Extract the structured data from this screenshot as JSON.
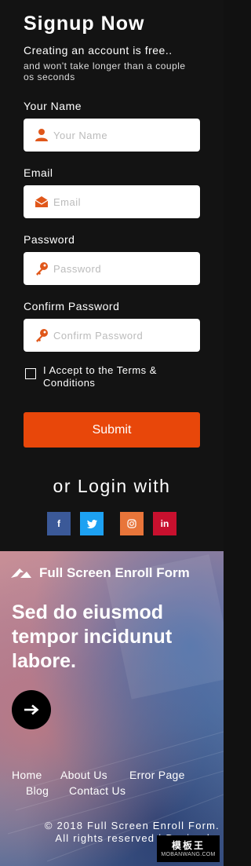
{
  "form": {
    "title": "Signup Now",
    "subtitle": "Creating an account is free..",
    "note": "and won't take longer than a couple os seconds",
    "fields": [
      {
        "label": "Your Name",
        "placeholder": "Your Name",
        "icon": "user-icon"
      },
      {
        "label": "Email",
        "placeholder": "Email",
        "icon": "envelope-icon"
      },
      {
        "label": "Password",
        "placeholder": "Password",
        "icon": "key-icon"
      },
      {
        "label": "Confirm Password",
        "placeholder": "Confirm Password",
        "icon": "key-icon"
      }
    ],
    "terms_label": "I Accept to the Terms & Conditions",
    "submit_label": "Submit"
  },
  "social": {
    "heading": "or Login with",
    "buttons": [
      {
        "name": "facebook",
        "glyph": "f",
        "color": "#3b5998"
      },
      {
        "name": "twitter",
        "glyph": "t",
        "color": "#1da1f2"
      },
      {
        "name": "instagram",
        "glyph": "◎",
        "color": "#e8753a"
      },
      {
        "name": "linkedin",
        "glyph": "in",
        "color": "#c8102e"
      }
    ]
  },
  "hero": {
    "brand": "Full Screen Enroll Form",
    "headline": "Sed do eiusmod tempor incidunut labore.",
    "nav": [
      "Home",
      "About Us",
      "Error Page",
      "Blog",
      "Contact Us"
    ],
    "copyright_line1": "© 2018 Full Screen Enroll Form.",
    "copyright_line2": "All rights reserved | Design by"
  },
  "watermark": {
    "main": "模板王",
    "sub": "MOBANWANG.COM"
  },
  "colors": {
    "accent": "#e8470a",
    "icon": "#e0571a",
    "panel": "#131313"
  }
}
